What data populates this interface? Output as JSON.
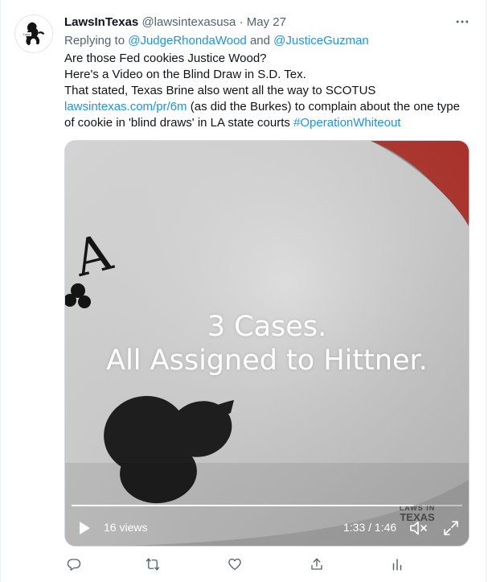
{
  "tweet": {
    "display_name": "LawsInTexas",
    "handle": "@lawsintexasusa",
    "separator": "·",
    "date": "May 27",
    "more_icon": "more-horizontal-icon",
    "replying_prefix": "Replying to",
    "mention_1": "@JudgeRhondaWood",
    "replying_and": "and",
    "mention_2": "@JusticeGuzman",
    "lines": {
      "l1": "Are those Fed cookies Justice Wood?",
      "l2": "Here's a Video on the Blind Draw in S.D. Tex.",
      "l3": "That stated, Texas Brine also went all the way to SCOTUS",
      "l4_link": "lawsintexas.com/pr/6m",
      "l4_rest": " (as did the Burkes) to complain about the one type",
      "l5_text": "of cookie in 'blind draws' in LA state courts ",
      "l5_hashtag": "#OperationWhiteout"
    },
    "colors": {
      "accent": "#1b95e0",
      "secondary": "#536471",
      "text": "#0f1419"
    }
  },
  "video": {
    "overlay_line1": "3 Cases.",
    "overlay_line2": "All Assigned to Hittner.",
    "views": "16 views",
    "time": "1:33 / 1:46",
    "progress": 0.877,
    "watermark_line1": "LAWS IN",
    "watermark_line2": "TEXAS",
    "card_rank": "A",
    "icons": {
      "play": "play-icon",
      "mute": "volume-muted-icon",
      "expand": "expand-icon"
    }
  },
  "actions": {
    "reply": "reply-icon",
    "retweet": "retweet-icon",
    "like": "heart-icon",
    "share": "share-icon",
    "analytics": "analytics-icon"
  }
}
